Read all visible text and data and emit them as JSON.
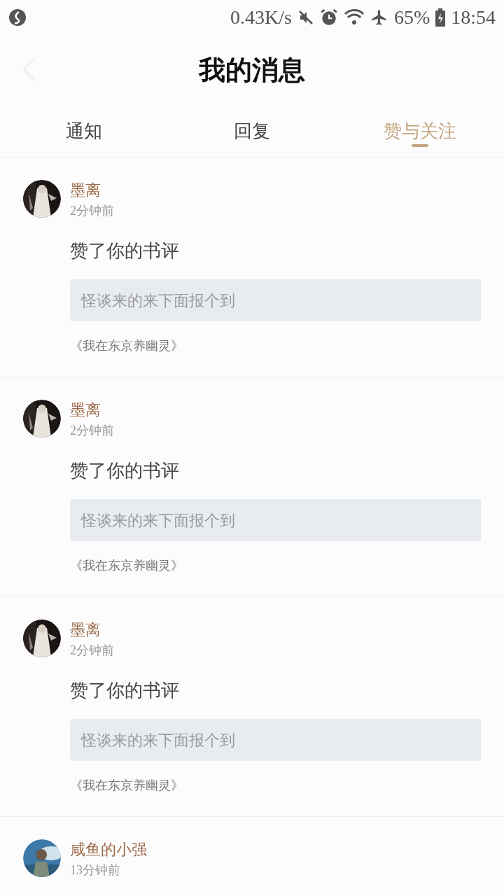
{
  "status_bar": {
    "speed": "0.43K/s",
    "battery": "65%",
    "time": "18:54"
  },
  "header": {
    "title": "我的消息"
  },
  "tabs": [
    {
      "label": "通知",
      "selected": false
    },
    {
      "label": "回复",
      "selected": false
    },
    {
      "label": "赞与关注",
      "selected": true
    }
  ],
  "messages": [
    {
      "name": "墨离",
      "time": "2分钟前",
      "action": "赞了你的书评",
      "quote": "怪谈来的来下面报个到",
      "book": "《我在东京养幽灵》"
    },
    {
      "name": "墨离",
      "time": "2分钟前",
      "action": "赞了你的书评",
      "quote": "怪谈来的来下面报个到",
      "book": "《我在东京养幽灵》"
    },
    {
      "name": "墨离",
      "time": "2分钟前",
      "action": "赞了你的书评",
      "quote": "怪谈来的来下面报个到",
      "book": "《我在东京养幽灵》"
    },
    {
      "name": "咸鱼的小强",
      "time": "13分钟前"
    }
  ]
}
